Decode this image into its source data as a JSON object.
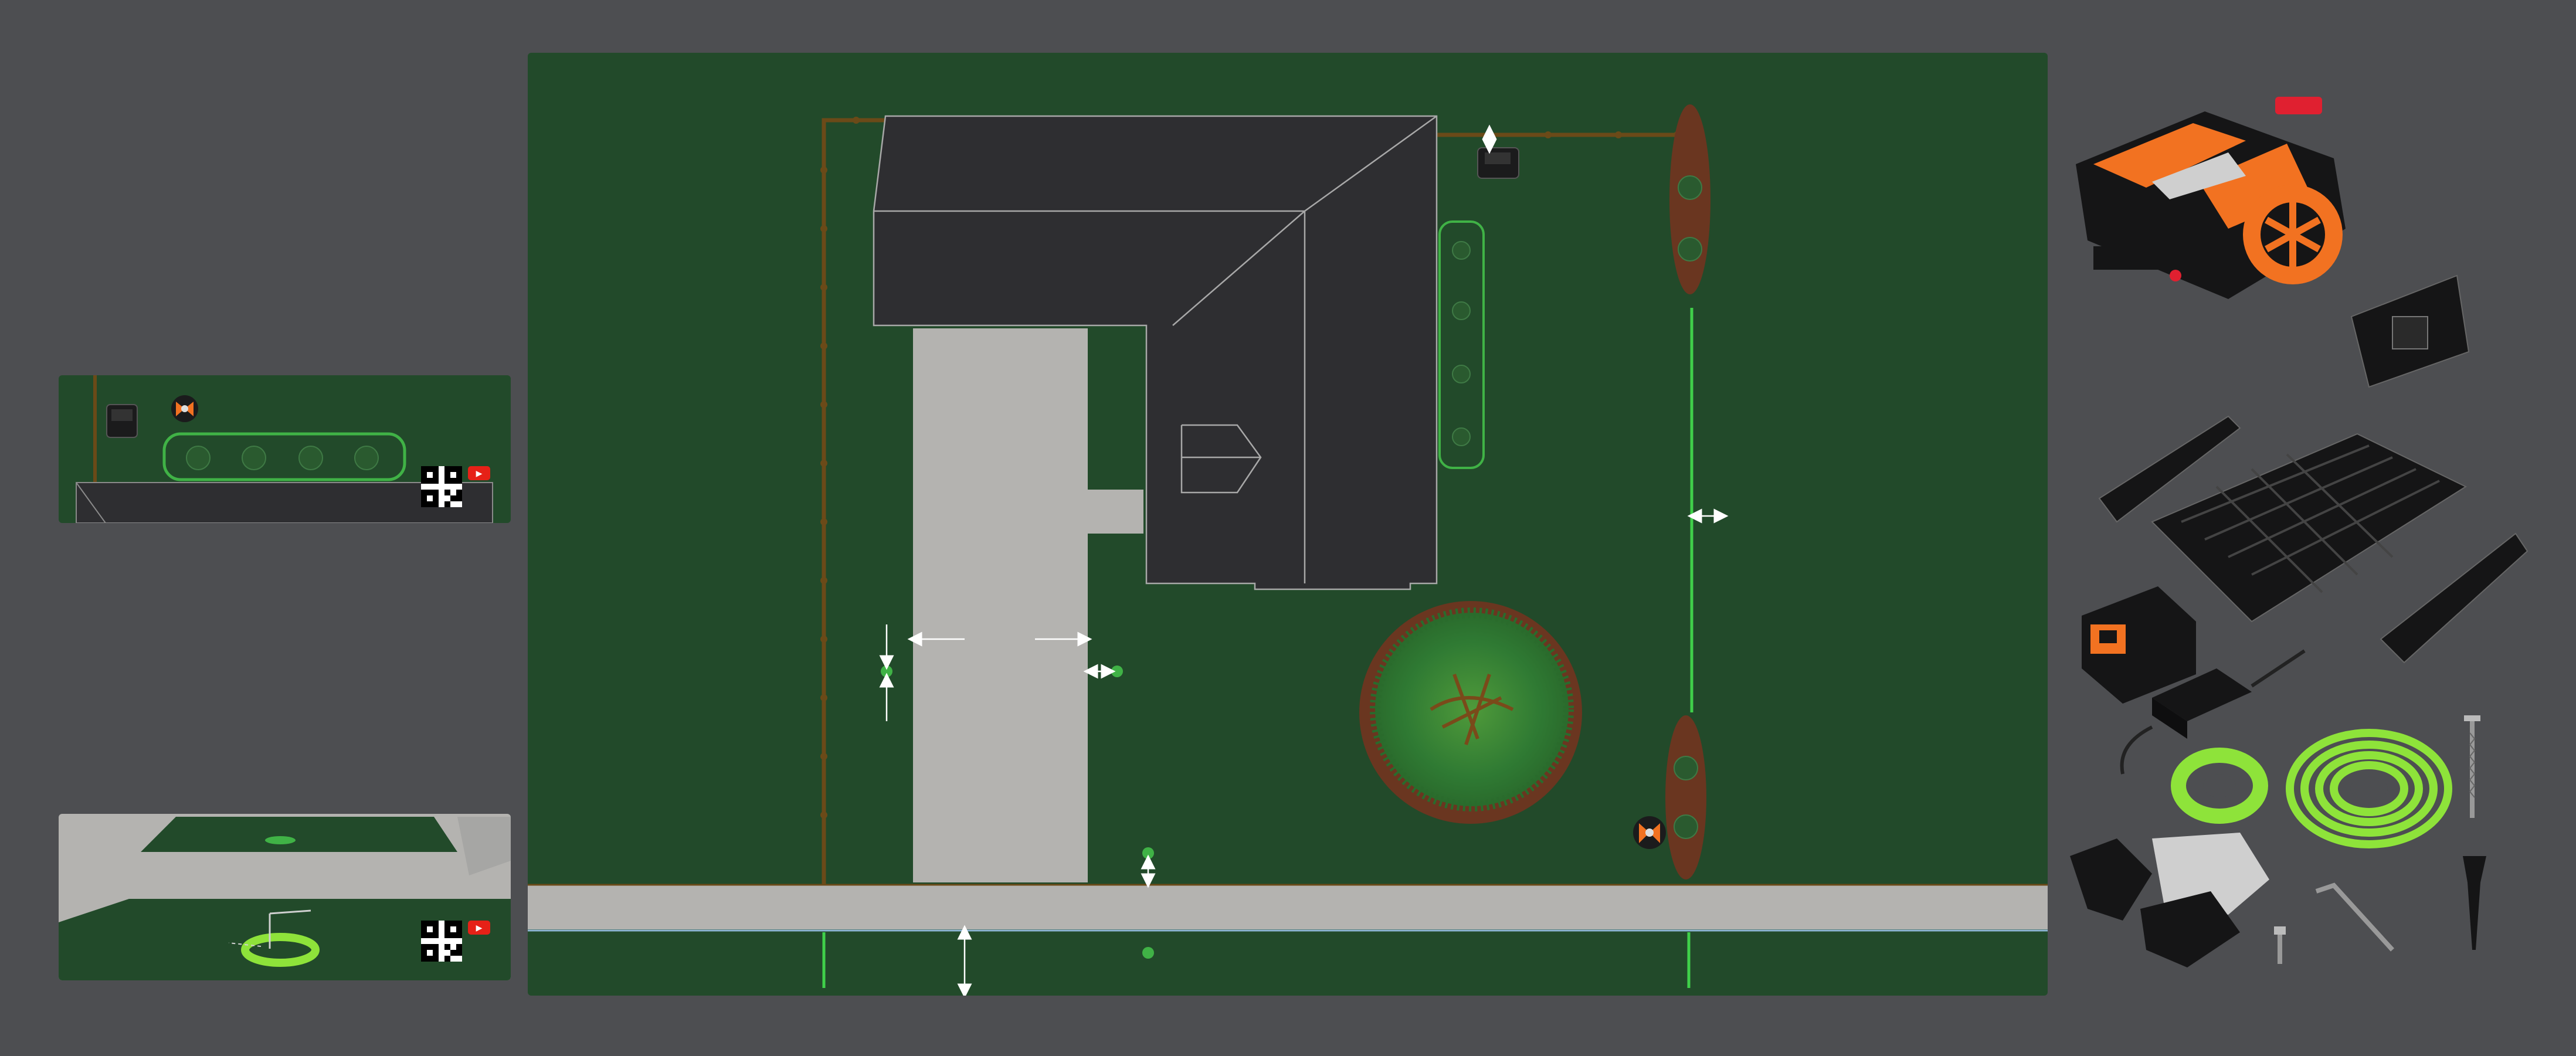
{
  "scene": {
    "background": "#4d4e51",
    "lawn_color": "#224a2a",
    "roof_color": "#2e2e31",
    "pavement_color": "#b4b3b0",
    "boundary_color": "#6b4a18",
    "flower_bed_color": "#6a3620",
    "marker_color": "#40b246",
    "accent_orange": "#f27221",
    "accessory_green": "#8ee33a"
  },
  "icons": {
    "youtube": "youtube-play-icon",
    "qr": "qr-code-icon",
    "mower": "robot-mower-icon",
    "dock": "charging-station-icon"
  },
  "youtube_glyph": "▶"
}
